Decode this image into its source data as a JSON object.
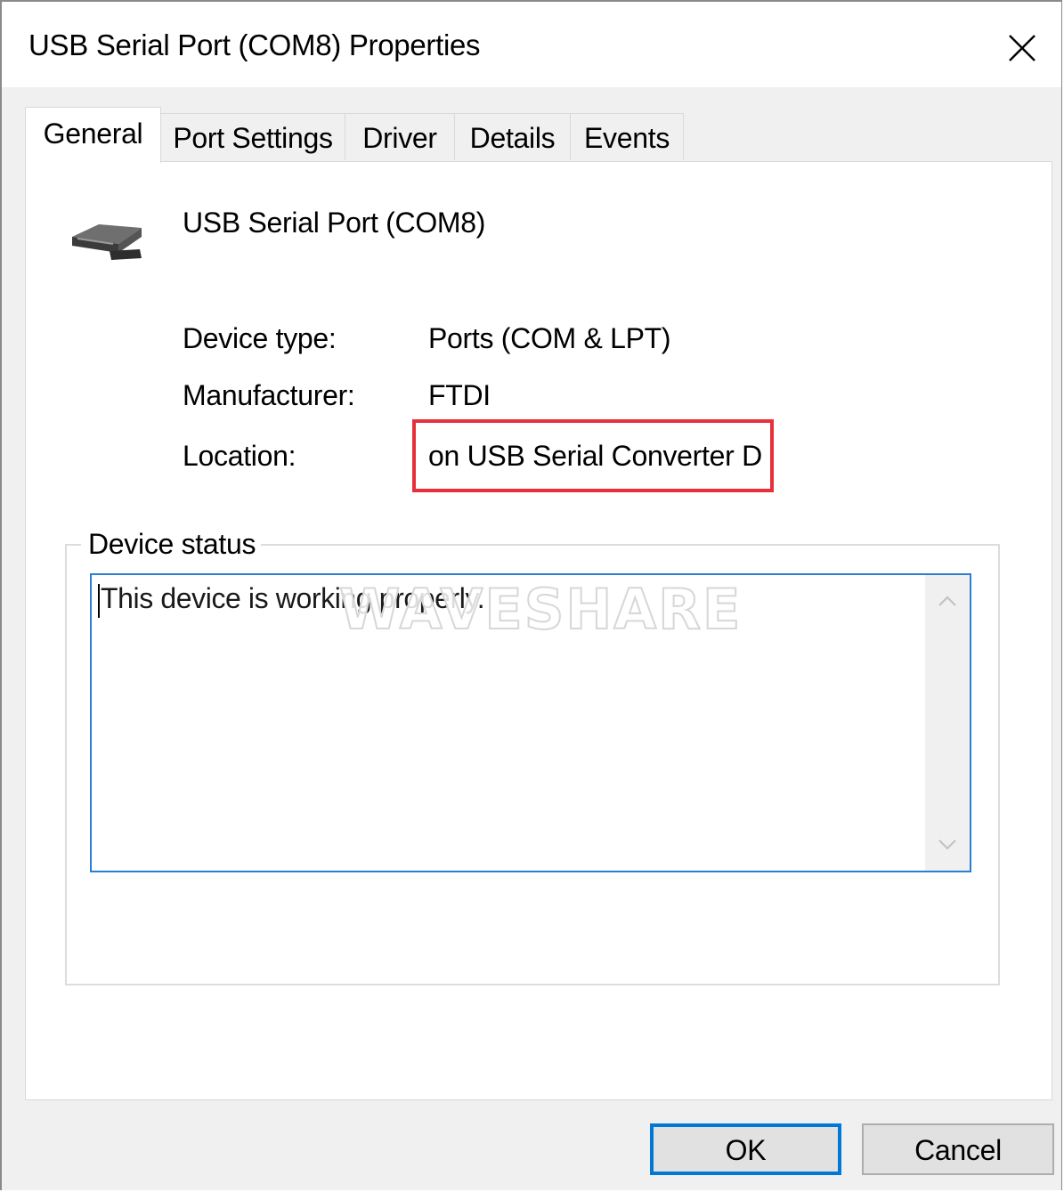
{
  "window": {
    "title": "USB Serial Port (COM8) Properties",
    "close_icon": "close-icon"
  },
  "tabs": [
    {
      "label": "General",
      "active": true
    },
    {
      "label": "Port Settings",
      "active": false
    },
    {
      "label": "Driver",
      "active": false
    },
    {
      "label": "Details",
      "active": false
    },
    {
      "label": "Events",
      "active": false
    }
  ],
  "general": {
    "device_icon": "serial-port-icon",
    "device_name": "USB Serial Port (COM8)",
    "properties": [
      {
        "label": "Device type:",
        "value": "Ports (COM & LPT)"
      },
      {
        "label": "Manufacturer:",
        "value": "FTDI"
      },
      {
        "label": "Location:",
        "value": "on USB Serial Converter D"
      }
    ],
    "highlight_color": "#e8303a",
    "device_status": {
      "legend": "Device status",
      "text": "This device is working properly.",
      "watermark": "WAVESHARE"
    }
  },
  "buttons": {
    "ok_label": "OK",
    "cancel_label": "Cancel",
    "default_color": "#0078d7"
  }
}
